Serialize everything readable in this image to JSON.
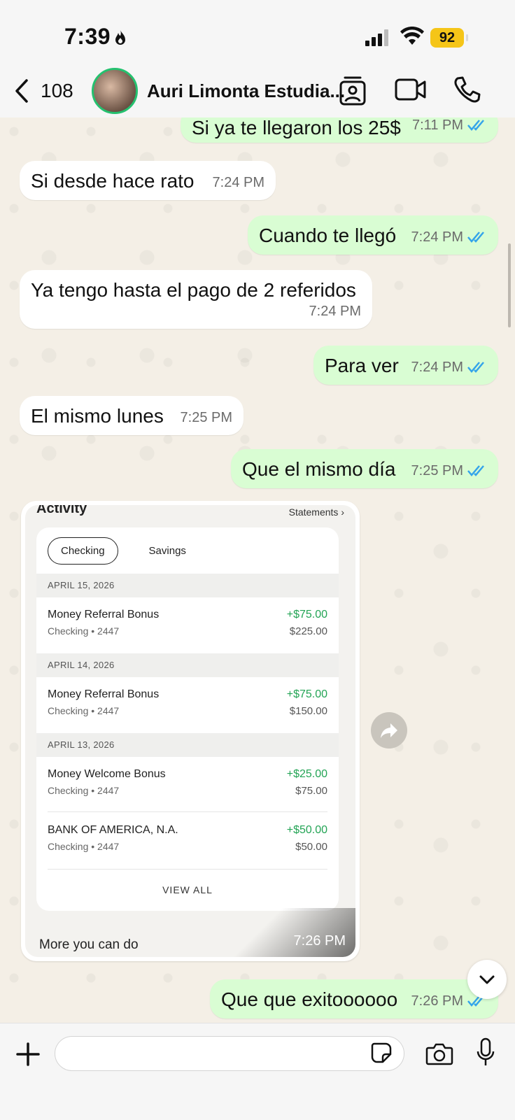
{
  "status": {
    "time": "7:39",
    "battery": "92"
  },
  "header": {
    "unread_count": "108",
    "contact_name": "Auri Limonta Estudia..."
  },
  "messages": [
    {
      "dir": "out",
      "text": "Si ya te llegaron los 25$",
      "time": "7:11 PM",
      "read": true
    },
    {
      "dir": "in",
      "text": "Si desde hace rato",
      "time": "7:24 PM"
    },
    {
      "dir": "out",
      "text": "Cuando te llegó",
      "time": "7:24 PM",
      "read": true
    },
    {
      "dir": "in",
      "text": "Ya tengo hasta el pago de 2 referidos",
      "time": "7:24 PM"
    },
    {
      "dir": "out",
      "text": "Para ver",
      "time": "7:24 PM",
      "read": true
    },
    {
      "dir": "in",
      "text": "El mismo lunes",
      "time": "7:25 PM"
    },
    {
      "dir": "out",
      "text": "Que el mismo día",
      "time": "7:25 PM",
      "read": true
    },
    {
      "dir": "out",
      "text": "Que que exitoooooo",
      "time": "7:26 PM",
      "read": true
    }
  ],
  "image_message": {
    "time": "7:26 PM",
    "activity_title": "Activity",
    "statements_link": "Statements",
    "tabs": [
      "Checking",
      "Savings"
    ],
    "groups": [
      {
        "date": "APRIL 15, 2026",
        "items": [
          {
            "title": "Money Referral Bonus",
            "sub": "Checking • 2447",
            "amount": "+$75.00",
            "balance": "$225.00"
          }
        ]
      },
      {
        "date": "APRIL 14, 2026",
        "items": [
          {
            "title": "Money Referral Bonus",
            "sub": "Checking • 2447",
            "amount": "+$75.00",
            "balance": "$150.00"
          }
        ]
      },
      {
        "date": "APRIL 13, 2026",
        "items": [
          {
            "title": "Money Welcome Bonus",
            "sub": "Checking • 2447",
            "amount": "+$25.00",
            "balance": "$75.00"
          },
          {
            "title": "BANK OF AMERICA, N.A.",
            "sub": "Checking • 2447",
            "amount": "+$50.00",
            "balance": "$50.00"
          }
        ]
      }
    ],
    "view_all": "VIEW ALL",
    "more_label": "More you can do"
  },
  "colors": {
    "outgoing": "#d9fdd3",
    "incoming": "#ffffff",
    "read_checks": "#34a4ea",
    "amount_green": "#23a455"
  }
}
